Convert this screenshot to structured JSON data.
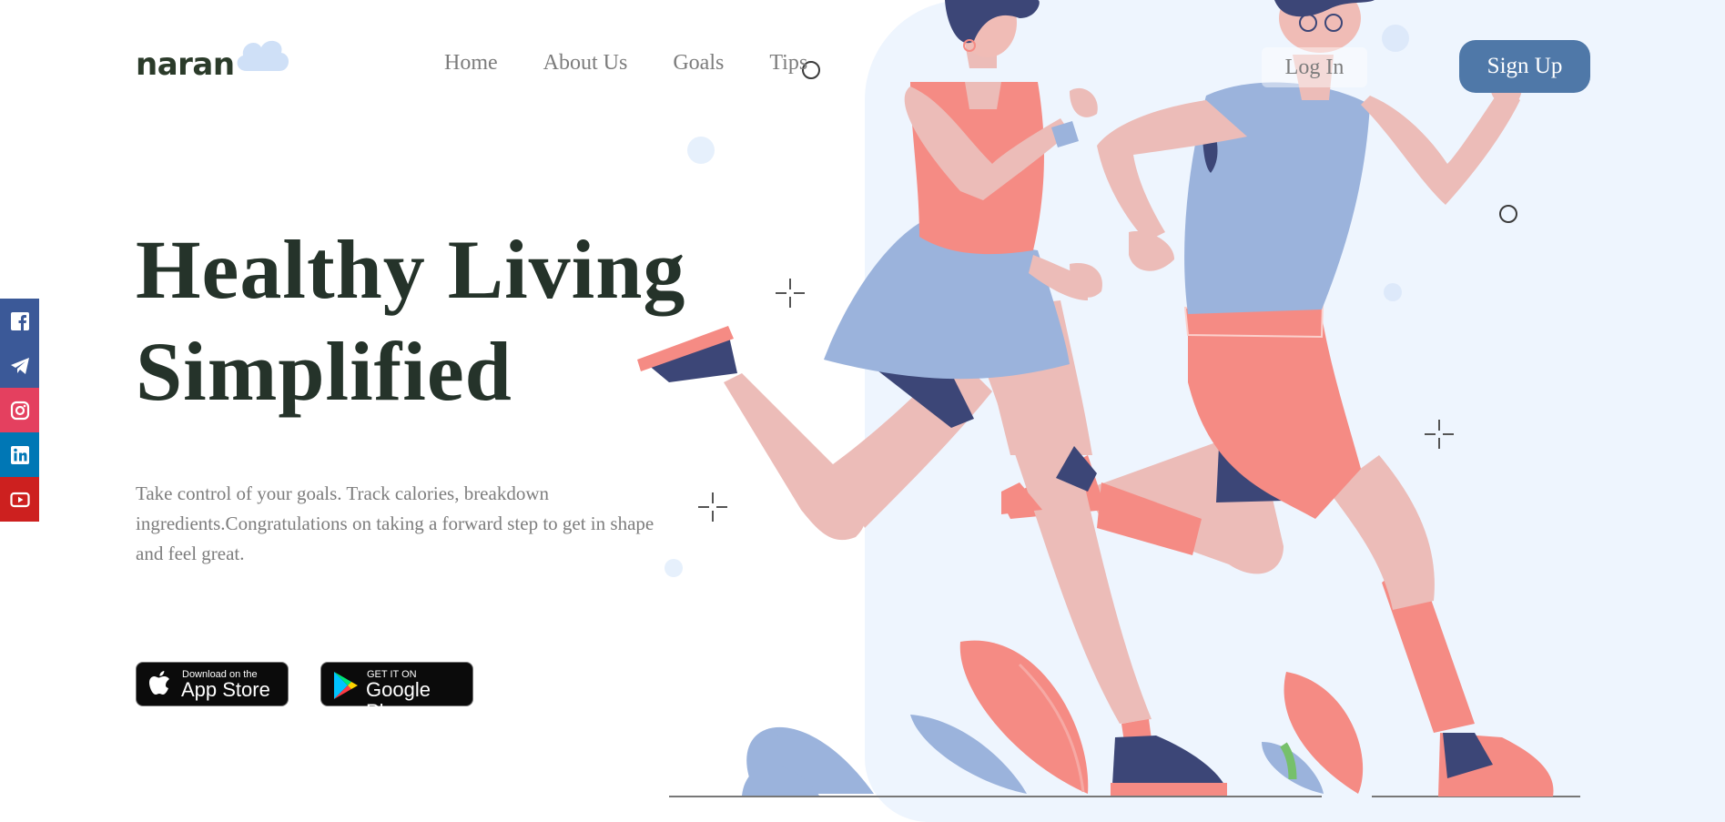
{
  "brand": {
    "name": "naran"
  },
  "nav": {
    "items": [
      {
        "label": "Home"
      },
      {
        "label": "About Us"
      },
      {
        "label": "Goals"
      },
      {
        "label": "Tips"
      }
    ]
  },
  "auth": {
    "login_label": "Log In",
    "signup_label": "Sign Up"
  },
  "hero": {
    "title_line1": "Healthy Living",
    "title_line2": "Simplified",
    "description": "Take control of your goals. Track calories, breakdown ingredients.Congratulations on taking a forward step to get in shape and feel great."
  },
  "stores": {
    "apple": {
      "small": "Download on the",
      "big": "App Store",
      "icon": "apple-icon"
    },
    "google": {
      "small": "GET IT ON",
      "big": "Google Play",
      "icon": "google-play-icon"
    }
  },
  "social": [
    {
      "name": "facebook",
      "icon": "facebook-icon",
      "color": "#3b5998"
    },
    {
      "name": "telegram",
      "icon": "telegram-icon",
      "color": "#3b5998"
    },
    {
      "name": "instagram",
      "icon": "instagram-icon",
      "color": "#e4405f"
    },
    {
      "name": "linkedin",
      "icon": "linkedin-icon",
      "color": "#0077b5"
    },
    {
      "name": "youtube",
      "icon": "youtube-icon",
      "color": "#cd201f"
    }
  ],
  "colors": {
    "accent": "#4f78a8",
    "heading": "#25332a",
    "hero_bg": "#eef5fe",
    "coral": "#f58b84",
    "skin": "#ecbcb8",
    "blue": "#9bb3dc",
    "navy": "#3c4677"
  }
}
